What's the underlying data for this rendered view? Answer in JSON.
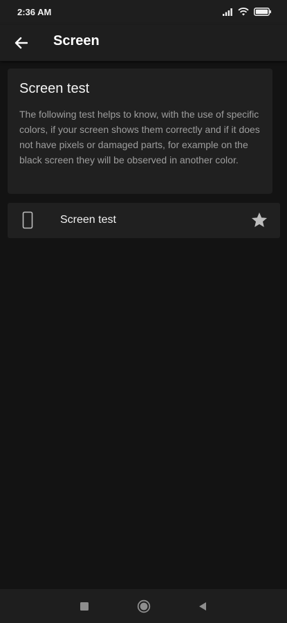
{
  "status_bar": {
    "time": "2:36 AM"
  },
  "app_bar": {
    "title": "Screen",
    "back_icon": "arrow-back-icon"
  },
  "info_card": {
    "title": "Screen test",
    "description": "The following test helps to know, with the use of specific colors, if your screen shows them correctly and if it does not have pixels or damaged parts, for example on the black screen they will be observed in another color."
  },
  "list": {
    "items": [
      {
        "label": "Screen test",
        "icon": "smartphone-icon",
        "action_icon": "star-icon"
      }
    ]
  },
  "nav_bar": {
    "icons": [
      "recents-square-icon",
      "home-circle-icon",
      "back-triangle-icon"
    ]
  },
  "colors": {
    "background": "#131313",
    "bar": "#1e1e1e",
    "card": "#202020",
    "secondary_text": "#9e9e9e",
    "icon_gray": "#bdbdbd"
  }
}
